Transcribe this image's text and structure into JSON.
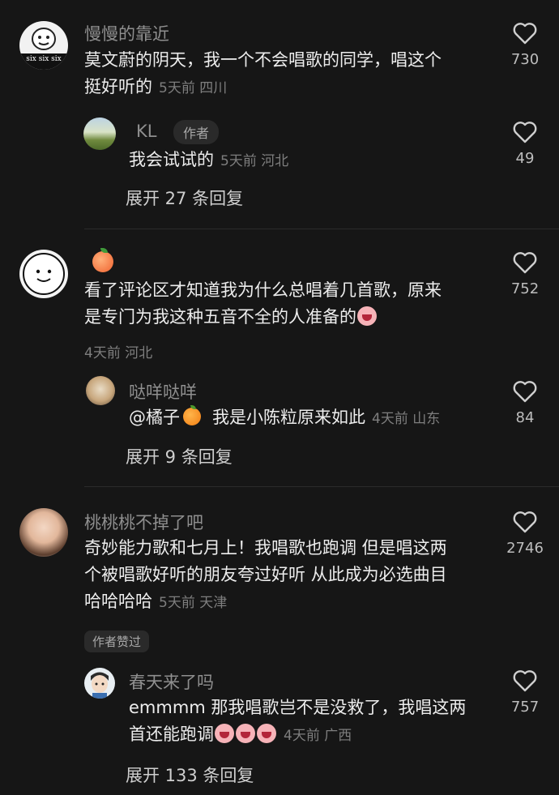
{
  "comments": [
    {
      "author": "慢慢的靠近",
      "avatar_text": "six six six",
      "text_lines": [
        "莫文蔚的阴天，我一个不会唱歌的同学，唱这个",
        "挺好听的"
      ],
      "time": "5天前",
      "location": "四川",
      "likes": "730",
      "reply": {
        "author": "KL",
        "author_tag": "作者",
        "text": "我会试试的",
        "time": "5天前",
        "location": "河北",
        "likes": "49"
      },
      "expand": "展开 27 条回复"
    },
    {
      "author_emoji": "peach",
      "text_lines": [
        "看了评论区才知道我为什么总唱着几首歌，原来",
        "是专门为我这种五音不全的人准备的"
      ],
      "time": "4天前",
      "location": "河北",
      "likes": "752",
      "reply": {
        "author": "哒咩哒咩",
        "mention": "@橘子",
        "text": "我是小陈粒原来如此",
        "time": "4天前",
        "location": "山东",
        "likes": "84"
      },
      "expand": "展开 9 条回复"
    },
    {
      "author": "桃桃桃不掉了吧",
      "text_lines": [
        "奇妙能力歌和七月上！我唱歌也跑调 但是唱这两",
        "个被唱歌好听的朋友夸过好听 从此成为必选曲目",
        "哈哈哈哈"
      ],
      "time": "5天前",
      "location": "天津",
      "likes": "2746",
      "liked_tag": "作者赞过",
      "reply": {
        "author": "春天来了吗",
        "text_lines": [
          "emmmm 那我唱歌岂不是没救了，我唱这两",
          "首还能跑调"
        ],
        "time": "4天前",
        "location": "广西",
        "likes": "757"
      },
      "expand": "展开 133 条回复"
    }
  ],
  "icons": {
    "like": "heart-outline-icon"
  },
  "colors": {
    "background": "#161616",
    "muted": "#7e7e7e",
    "name": "#8f8f8f"
  }
}
